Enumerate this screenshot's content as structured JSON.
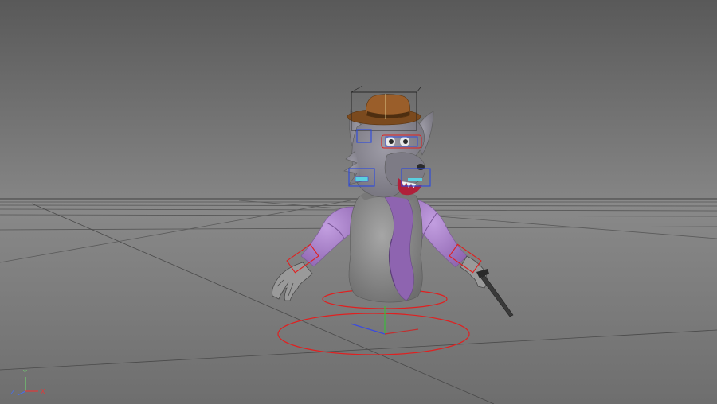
{
  "viewport": {
    "view": "perspective",
    "grid": true,
    "background_top": "#5a5a5a",
    "background_bottom": "#878787",
    "floor_color": "#7a7a7a",
    "grid_color": "#505050"
  },
  "axis_gizmo": {
    "x_label": "X",
    "y_label": "Y",
    "z_label": "Z",
    "x_color": "#e03a3a",
    "y_color": "#6fd06f",
    "z_color": "#4a6ee8"
  },
  "model": {
    "type": "wolf character bust rig",
    "colors": {
      "fur": "#8c8a93",
      "jacket_purple": "#a77cc8",
      "stripe_purple": "#7a5a9a",
      "hat": "#8a5a2a",
      "body_gray": "#8e8e8e",
      "control_red": "#e02020",
      "control_blue": "#2a48e0"
    }
  }
}
